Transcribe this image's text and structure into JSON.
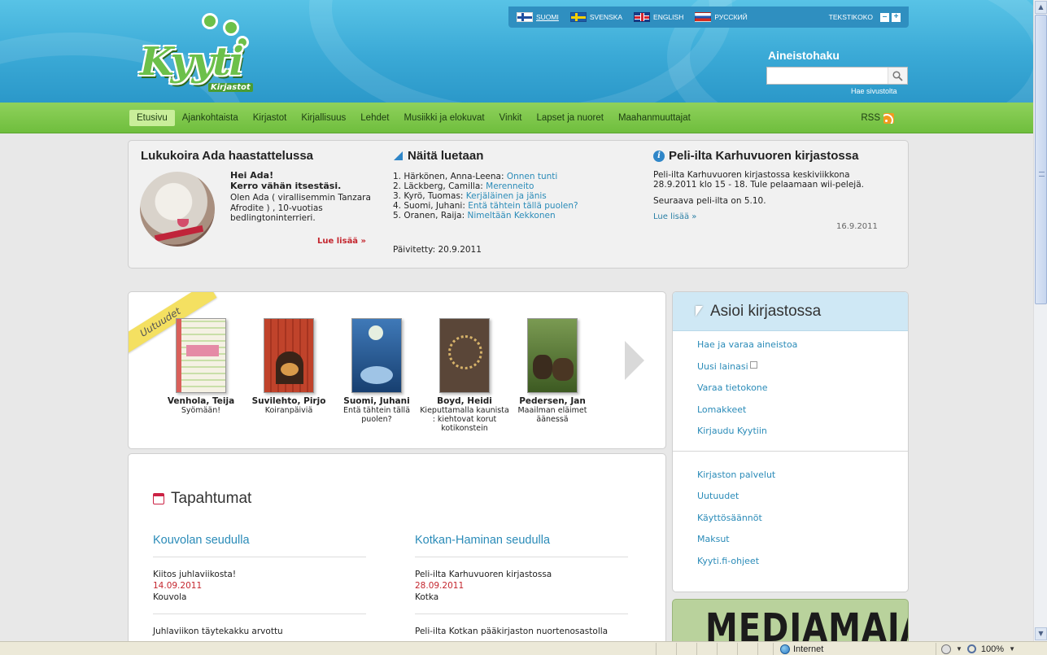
{
  "header": {
    "languages": [
      {
        "label": "SUOMI",
        "flag": "fi",
        "active": true
      },
      {
        "label": "SVENSKA",
        "flag": "se",
        "active": false
      },
      {
        "label": "ENGLISH",
        "flag": "gb",
        "active": false
      },
      {
        "label": "РУССКИЙ",
        "flag": "ru",
        "active": false
      }
    ],
    "textsize_label": "TEKSTIKOKO",
    "textsize_minus": "–",
    "textsize_plus": "+",
    "logo_text": "Kyyti",
    "logo_sub": "Kirjastot",
    "search_title": "Aineistohaku",
    "search_value": "",
    "search_icon": "magnifier-icon",
    "site_search_label": "Hae sivustolta"
  },
  "nav": {
    "items": [
      "Etusivu",
      "Ajankohtaista",
      "Kirjastot",
      "Kirjallisuus",
      "Lehdet",
      "Musiikki ja elokuvat",
      "Vinkit",
      "Lapset ja nuoret",
      "Maahanmuuttajat"
    ],
    "active_index": 0,
    "rss_label": "RSS"
  },
  "info": {
    "ada": {
      "title": "Lukukoira Ada haastattelussa",
      "q1": "Hei Ada!",
      "q2": "Kerro vähän itsestäsi.",
      "answer": "Olen Ada ( virallisemmin Tanzara Afrodite ) , 10-vuotias bedlingtoninterrieri.",
      "more": "Lue lisää »"
    },
    "read": {
      "title": "Näitä luetaan",
      "items": [
        {
          "author": "1. Härkönen, Anna-Leena: ",
          "title": "Onnen tunti"
        },
        {
          "author": "2. Läckberg, Camilla: ",
          "title": "Merenneito"
        },
        {
          "author": "3. Kyrö, Tuomas: ",
          "title": "Kerjäläinen ja jänis"
        },
        {
          "author": "4. Suomi, Juhani: ",
          "title": "Entä tähtein tällä puolen?"
        },
        {
          "author": "5. Oranen, Raija: ",
          "title": "Nimeltään Kekkonen"
        }
      ],
      "updated": "Päivitetty: 20.9.2011"
    },
    "peli": {
      "title": "Peli-ilta Karhuvuoren kirjastossa",
      "text": "Peli-ilta Karhuvuoren kirjastossa keskiviikkona 28.9.2011 klo 15 - 18. Tule pelaamaan wii-pelejä.",
      "next": "Seuraava peli-ilta on 5.10.",
      "more": "Lue lisää »",
      "date": "16.9.2011"
    }
  },
  "books": {
    "ribbon": "Uutuudet",
    "items": [
      {
        "author": "Venhola, Teija",
        "title": "Syömään!",
        "color": "#c9dfa8",
        "accent": "#e58aa6"
      },
      {
        "author": "Suvilehto, Pirjo",
        "title": "Koiranpäiviä",
        "color": "#c0432b",
        "accent": "#4a2a1a"
      },
      {
        "author": "Suomi, Juhani",
        "title": "Entä tähtein tällä puolen?",
        "color": "#2a5d98",
        "accent": "#9fc4e6"
      },
      {
        "author": "Boyd, Heidi",
        "title": "Kieputtamalla kaunista : kiehtovat korut kotikonstein",
        "color": "#5a4638",
        "accent": "#d7b36a"
      },
      {
        "author": "Pedersen, Jan",
        "title": "Maailman eläimet äänessä",
        "color": "#5b7a3a",
        "accent": "#3b2c1e"
      }
    ]
  },
  "events": {
    "title": "Tapahtumat",
    "columns": [
      {
        "heading": "Kouvolan seudulla",
        "items": [
          {
            "title": "Kiitos juhlaviikosta!",
            "date": "14.09.2011",
            "place": "Kouvola"
          },
          {
            "title": "Juhlaviikon täytekakku arvottu",
            "date": "",
            "place": ""
          }
        ]
      },
      {
        "heading": "Kotkan-Haminan seudulla",
        "items": [
          {
            "title": "Peli-ilta Karhuvuoren kirjastossa",
            "date": "28.09.2011",
            "place": "Kotka"
          },
          {
            "title": "Peli-ilta Kotkan pääkirjaston nuortenosastolla",
            "date": "",
            "place": ""
          }
        ]
      }
    ]
  },
  "asioi": {
    "title": "Asioi kirjastossa",
    "links": [
      "Hae ja varaa aineistoa",
      "Uusi lainasi",
      "Varaa tietokone",
      "Lomakkeet",
      "Kirjaudu Kyytiin"
    ],
    "links2": [
      "Kirjaston palvelut",
      "Uutuudet",
      "Käyttösäännöt",
      "Maksut",
      "Kyyti.fi-ohjeet"
    ]
  },
  "banner": {
    "text": "MEDIAMAJA"
  },
  "statusbar": {
    "zone": "Internet",
    "zoom": "100%"
  }
}
